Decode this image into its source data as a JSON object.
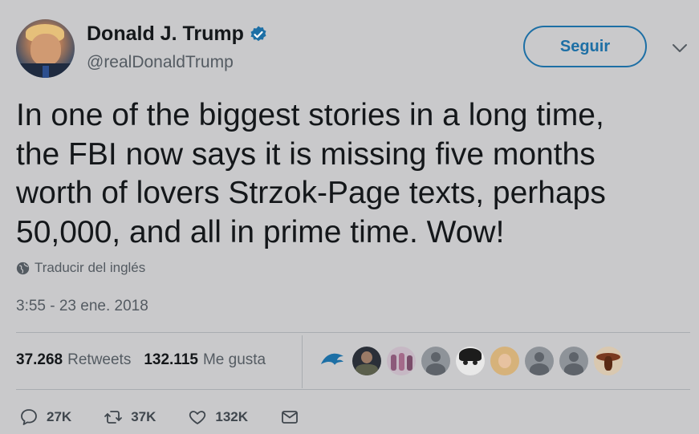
{
  "user": {
    "display_name": "Donald J. Trump",
    "handle": "@realDonaldTrump",
    "verified": true
  },
  "follow_button": {
    "label": "Seguir"
  },
  "tweet": {
    "text": "In one of the biggest stories in a long time,\nthe FBI now says it is missing five months\nworth of lovers Strzok-Page texts, perhaps\n50,000, and all in prime time. Wow!",
    "translate_label": "Traducir del inglés",
    "timestamp": "3:55 - 23 ene. 2018"
  },
  "stats": {
    "retweets_count": "37.268",
    "retweets_label": "Retweets",
    "likes_count": "132.115",
    "likes_label": "Me gusta"
  },
  "actions": {
    "reply_count": "27K",
    "retweet_count": "37K",
    "like_count": "132K"
  },
  "colors": {
    "background": "#c9c9cb",
    "accent": "#1d6fa5",
    "verified": "#1d6fa5",
    "text": "#14171a",
    "muted": "#545b62"
  },
  "liker_avatars": [
    {
      "icon": "blue-bird-logo-avatar"
    },
    {
      "icon": "person-photo-avatar"
    },
    {
      "icon": "group-photo-avatar"
    },
    {
      "icon": "default-avatar"
    },
    {
      "icon": "cartoon-face-avatar"
    },
    {
      "icon": "blonde-person-avatar"
    },
    {
      "icon": "default-avatar"
    },
    {
      "icon": "default-avatar"
    },
    {
      "icon": "eagle-emblem-avatar"
    }
  ]
}
